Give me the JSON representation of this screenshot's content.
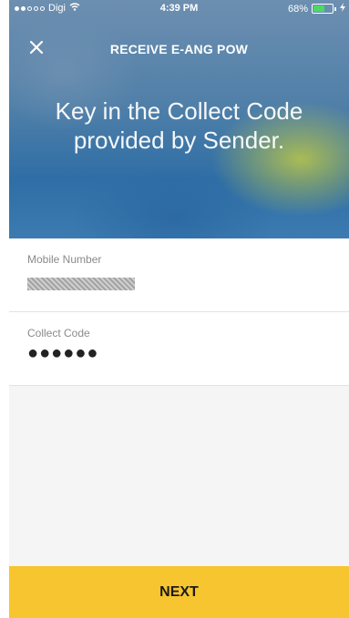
{
  "status_bar": {
    "carrier": "Digi",
    "time": "4:39 PM",
    "battery_percent": "68%",
    "battery_level": 0.68,
    "icons": [
      "signal-dots-icon",
      "wifi-icon",
      "battery-icon",
      "charging-icon"
    ]
  },
  "nav": {
    "title": "RECEIVE E-ANG POW",
    "close_icon": "close-icon"
  },
  "hero": {
    "headline": "Key in the Collect Code provided by Sender."
  },
  "form": {
    "mobile_number": {
      "label": "Mobile Number",
      "value_state": "redacted"
    },
    "collect_code": {
      "label": "Collect Code",
      "value": "●●●●●●"
    }
  },
  "actions": {
    "next_label": "NEXT"
  },
  "colors": {
    "accent": "#f7c52f",
    "hero_blue": "#2f6ea6",
    "battery_green": "#4cd964"
  }
}
